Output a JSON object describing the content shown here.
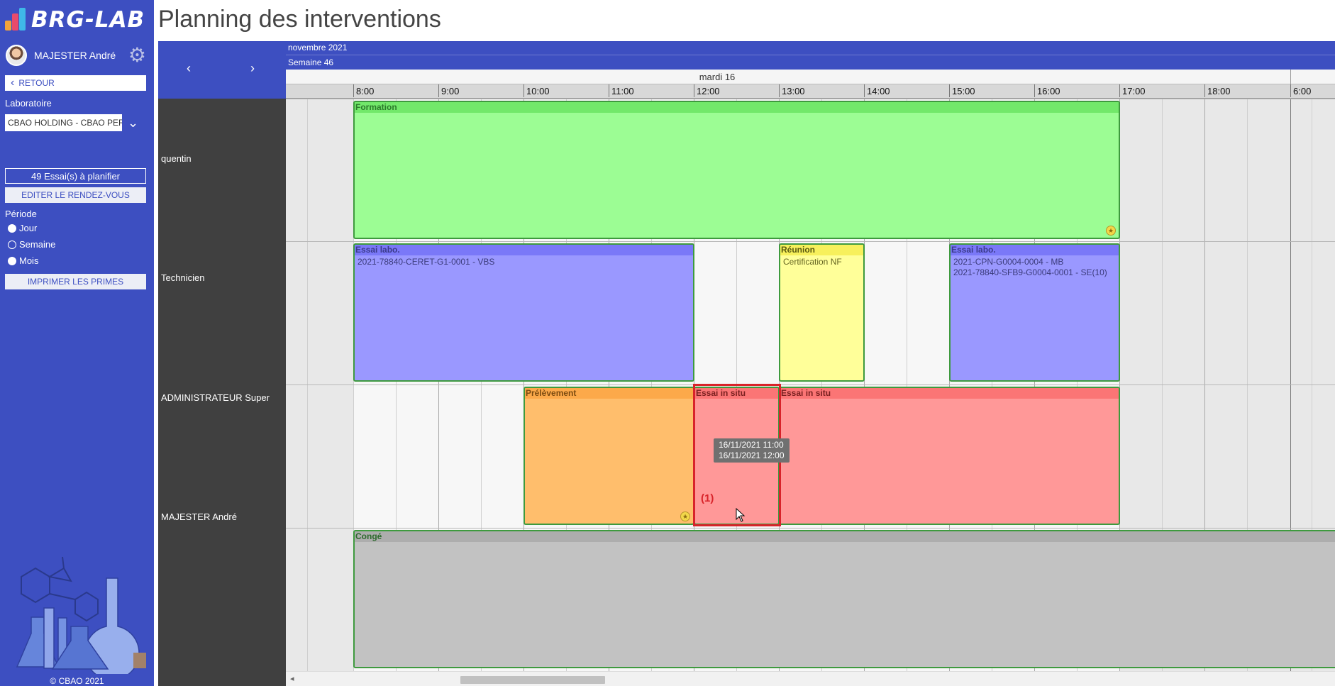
{
  "app": {
    "logo_text": "BRG-LAB",
    "title": "Planning des interventions",
    "copyright": "© CBAO 2021"
  },
  "sidebar": {
    "user_name": "MAJESTER André",
    "back_label": "RETOUR",
    "lab_label": "Laboratoire",
    "lab_value": "CBAO HOLDING - CBAO PERPIGNAN",
    "essais_count": "49 Essai(s) à planifier",
    "edit_label": "EDITER LE RENDEZ-VOUS",
    "period_label": "Période",
    "periods": [
      {
        "label": "Jour",
        "selected": false
      },
      {
        "label": "Semaine",
        "selected": true
      },
      {
        "label": "Mois",
        "selected": false
      }
    ],
    "print_label": "IMPRIMER LES PRIMES"
  },
  "planner": {
    "nav_prev": "‹",
    "nav_next": "›",
    "month": "novembre 2021",
    "week": "Semaine 46",
    "day": "mardi 16",
    "hours": [
      "8:00",
      "9:00",
      "10:00",
      "11:00",
      "12:00",
      "13:00",
      "14:00",
      "15:00",
      "16:00",
      "17:00",
      "18:00",
      "6:00"
    ],
    "resources": [
      "quentin",
      "Technicien",
      "ADMINISTRATEUR Super",
      "MAJESTER André"
    ],
    "events": [
      {
        "title": "Formation",
        "details": [],
        "color": "#9cfd94",
        "header_color": "#72e86a"
      },
      {
        "title": "Essai labo.",
        "details": [
          "2021-78840-CERET-G1-0001 - VBS"
        ],
        "color": "#9a98ff",
        "header_color": "#7a78f8"
      },
      {
        "title": "Réunion",
        "details": [
          "Certification NF"
        ],
        "color": "#ffff99",
        "header_color": "#f7f05c"
      },
      {
        "title": "Essai labo.",
        "details": [
          "2021-CPN-G0004-0004 - MB",
          "2021-78840-SFB9-G0004-0001 - SE(10)"
        ],
        "color": "#9a98ff",
        "header_color": "#7a78f8"
      },
      {
        "title": "Prélèvement",
        "details": [],
        "color": "#ffbe6c",
        "header_color": "#fca94a"
      },
      {
        "title": "Essai in situ",
        "details": [],
        "color": "#ff9898",
        "header_color": "#fb7575"
      },
      {
        "title": "Essai in situ",
        "details": [],
        "color": "#ff9898",
        "header_color": "#fb7575"
      },
      {
        "title": "Congé",
        "details": [],
        "color": "#c2c2c2",
        "header_color": "#adadad"
      }
    ],
    "tooltip": [
      "16/11/2021 11:00",
      "16/11/2021 12:00"
    ],
    "marker": "(1)"
  }
}
